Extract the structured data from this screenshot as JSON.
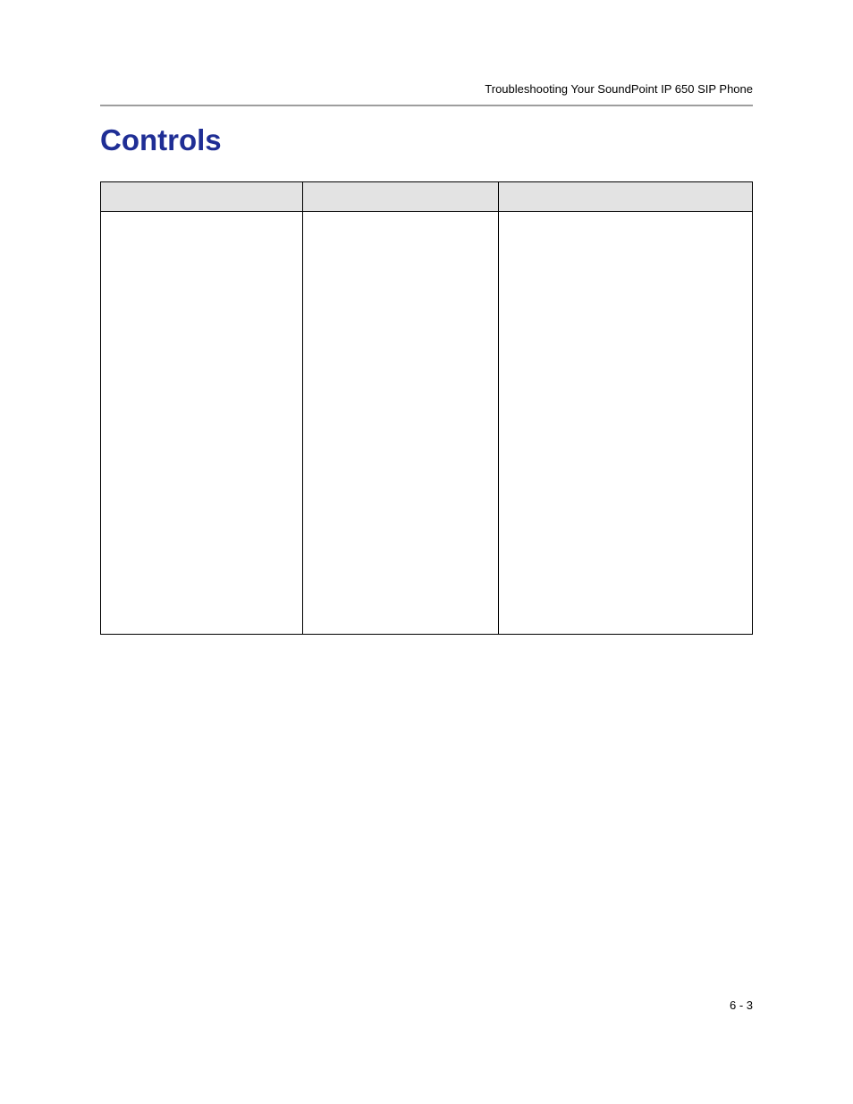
{
  "header": {
    "running_head": "Troubleshooting Your SoundPoint IP 650 SIP Phone"
  },
  "section": {
    "title": "Controls"
  },
  "table": {
    "headers": [
      "",
      "",
      ""
    ],
    "rows": [
      [
        "",
        "",
        ""
      ]
    ]
  },
  "footer": {
    "page_number": "6 - 3"
  }
}
